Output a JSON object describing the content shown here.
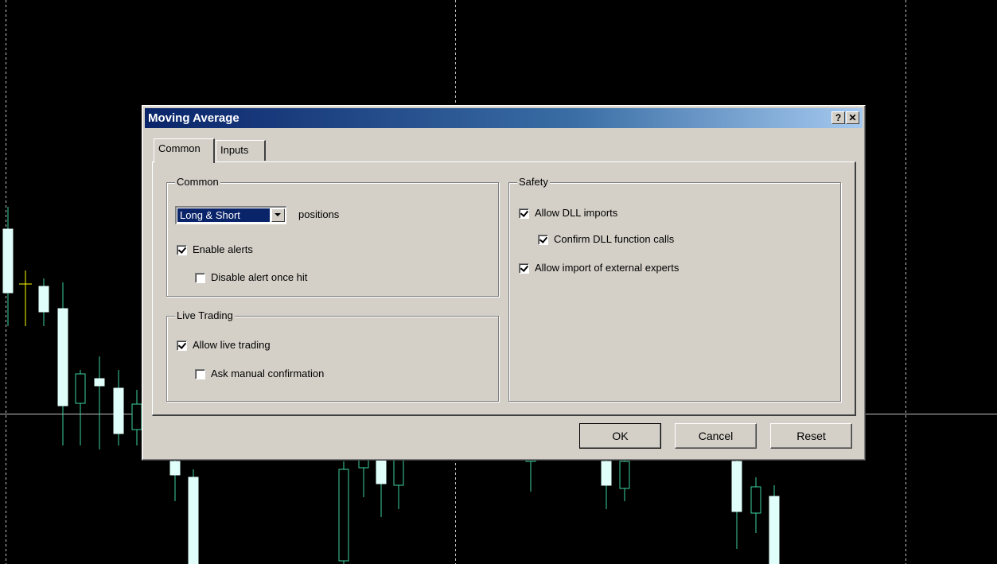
{
  "window": {
    "title": "Moving Average",
    "help_button": "?",
    "close_button": "✕"
  },
  "tabs": [
    {
      "label": "Common",
      "active": true
    },
    {
      "label": "Inputs",
      "active": false
    }
  ],
  "common_group": {
    "label": "Common",
    "positions_select": {
      "value": "Long & Short"
    },
    "positions_label": "positions",
    "enable_alerts": {
      "label": "Enable alerts",
      "checked": true
    },
    "disable_alert_once_hit": {
      "label": "Disable alert once hit",
      "checked": false
    }
  },
  "live_trading_group": {
    "label": "Live Trading",
    "allow_live_trading": {
      "label": "Allow live trading",
      "checked": true
    },
    "ask_manual_confirmation": {
      "label": "Ask manual confirmation",
      "checked": false
    }
  },
  "safety_group": {
    "label": "Safety",
    "allow_dll_imports": {
      "label": "Allow DLL imports",
      "checked": true
    },
    "confirm_dll_calls": {
      "label": "Confirm DLL function calls",
      "checked": true
    },
    "allow_external_experts": {
      "label": "Allow import of external experts",
      "checked": true
    }
  },
  "buttons": {
    "ok": "OK",
    "cancel": "Cancel",
    "reset": "Reset"
  },
  "colors": {
    "chart_background": "#000000",
    "candle_body_up": "#e0fffa",
    "candle_wick": "#3cd2a0",
    "cursor_candle": "#ffff00",
    "grid": "#c0c0c0",
    "crosshair": "#c0c0c0",
    "dialog_face": "#d4d0c8",
    "title_gradient_start": "#0a246a",
    "selection": "#0a246a"
  }
}
